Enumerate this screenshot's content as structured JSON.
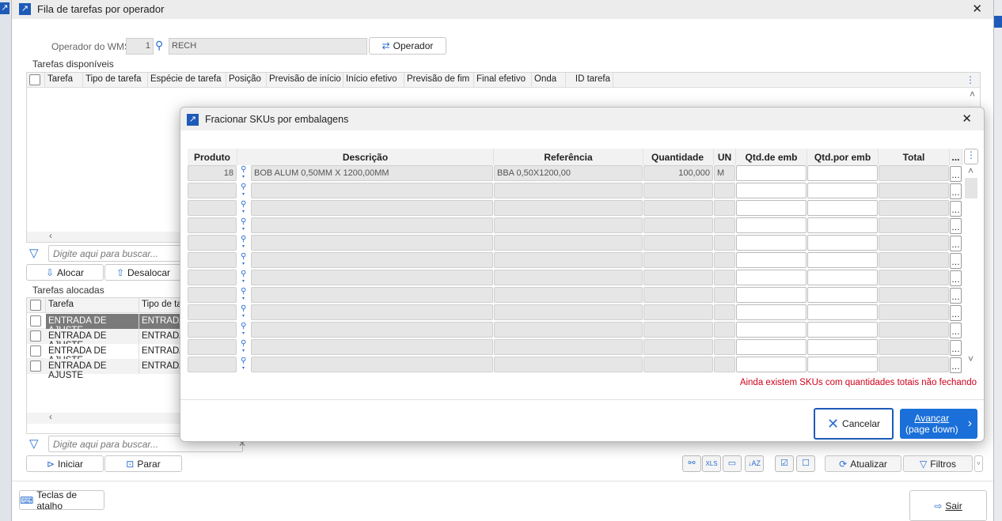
{
  "window": {
    "title": "Fila de tarefas por operador",
    "close": "✕"
  },
  "operator": {
    "label": "Operador do WMS",
    "code": "1",
    "name": "RECH",
    "button": "Operador"
  },
  "available": {
    "label": "Tarefas disponíveis",
    "columns": [
      "Tarefa",
      "Tipo de tarefa",
      "Espécie de tarefa",
      "Posição",
      "Previsão de início",
      "Início efetivo",
      "Previsão de fim",
      "Final efetivo",
      "Onda",
      "ID tarefa"
    ],
    "search_placeholder": "Digite aqui para buscar..."
  },
  "actions": {
    "allocate": "Alocar",
    "deallocate": "Desalocar",
    "start": "Iniciar",
    "stop": "Parar"
  },
  "allocated": {
    "label": "Tarefas alocadas",
    "columns": [
      "Tarefa",
      "Tipo de tarefa"
    ],
    "rows": [
      [
        "ENTRADA DE AJUSTE",
        "ENTRADA"
      ],
      [
        "ENTRADA DE AJUSTE",
        "ENTRADA"
      ],
      [
        "ENTRADA DE AJUSTE",
        "ENTRADA"
      ],
      [
        "ENTRADA DE AJUSTE",
        "ENTRADA"
      ]
    ],
    "search_placeholder": "Digite aqui para buscar..."
  },
  "toolbar": {
    "refresh": "Atualizar",
    "filters": "Filtros"
  },
  "footer": {
    "shortcuts": "Teclas de atalho",
    "exit": "Sair"
  },
  "dialog": {
    "title": "Fracionar SKUs por embalagens",
    "columns": [
      "Produto",
      "Descrição",
      "Referência",
      "Quantidade",
      "UN",
      "Qtd.de emb",
      "Qtd.por emb",
      "Total",
      "..."
    ],
    "rows": [
      {
        "produto": "18",
        "descricao": "BOB ALUM 0,50MM X 1200,00MM",
        "referencia": "BBA 0,50X1200,00",
        "quantidade": "100,000",
        "un": "M",
        "qtd_emb": "",
        "qtd_por_emb": "",
        "total": ""
      }
    ],
    "empty_rows": 11,
    "warning": "Ainda existem SKUs com quantidades totais não fechando",
    "warning_color": "#d0021b",
    "cancel": "Cancelar",
    "next": "Avançar",
    "next_hint": "(page down)",
    "accent": "#1a6fd8"
  }
}
